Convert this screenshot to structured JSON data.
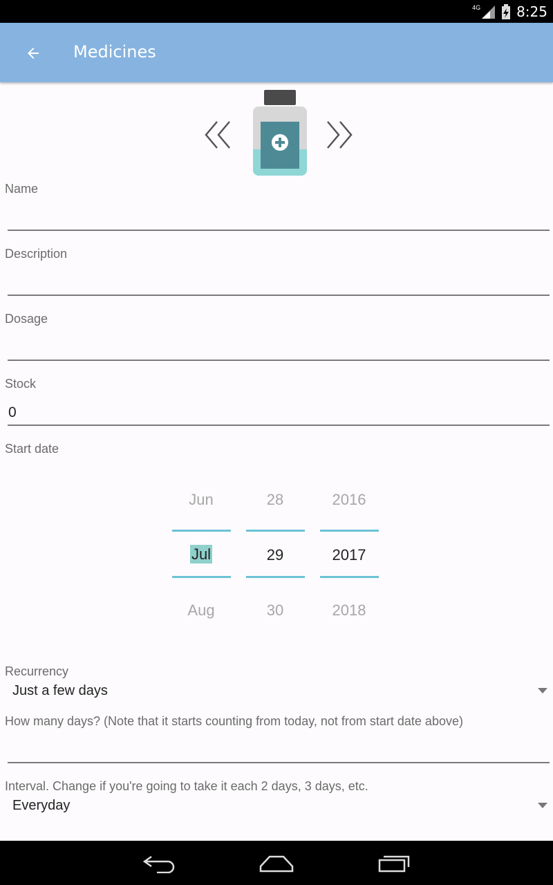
{
  "status_bar": {
    "network": "4G",
    "time": "8:25"
  },
  "app_bar": {
    "title": "Medicines",
    "back_icon": "arrow-back-icon"
  },
  "pager": {
    "prev_icon": "double-chevron-left-icon",
    "image_icon": "medicine-bottle-icon",
    "next_icon": "double-chevron-right-icon"
  },
  "form": {
    "name": {
      "label": "Name",
      "value": ""
    },
    "description": {
      "label": "Description",
      "value": ""
    },
    "dosage": {
      "label": "Dosage",
      "value": ""
    },
    "stock": {
      "label": "Stock",
      "value": "0"
    },
    "start_date": {
      "label": "Start date",
      "month": {
        "prev": "Jun",
        "selected": "Jul",
        "next": "Aug"
      },
      "day": {
        "prev": "28",
        "selected": "29",
        "next": "30"
      },
      "year": {
        "prev": "2016",
        "selected": "2017",
        "next": "2018"
      }
    },
    "recurrency": {
      "label": "Recurrency",
      "value": "Just a few days"
    },
    "how_many_days": {
      "label": "How many days? (Note that it starts counting from today, not from start date above)",
      "value": ""
    },
    "interval": {
      "label": "Interval. Change if you're going to take it each 2 days, 3 days, etc.",
      "value": "Everyday"
    }
  },
  "nav_bar": {
    "back_icon": "nav-back-icon",
    "home_icon": "nav-home-icon",
    "recents_icon": "nav-recents-icon"
  },
  "colors": {
    "app_bar": "#86b3df",
    "accent": "#6cc2d6",
    "bottle_body": "#4e8a96",
    "bottle_liquid": "#8fd6d6"
  }
}
